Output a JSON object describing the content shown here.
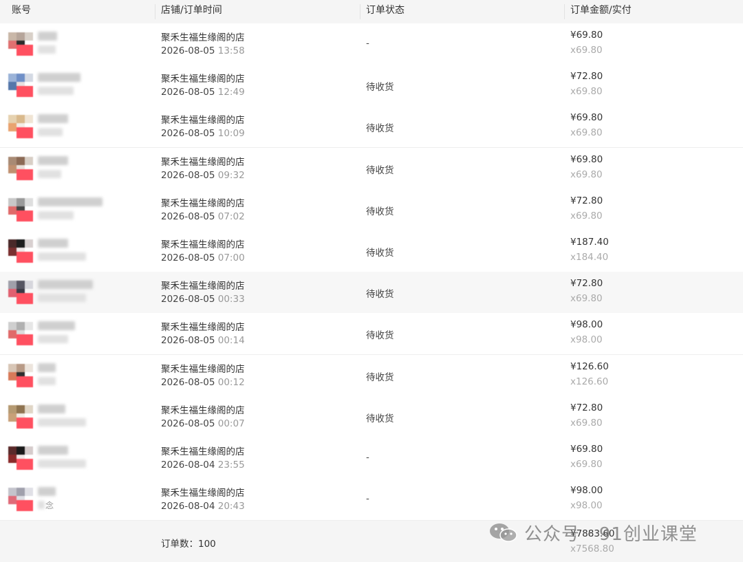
{
  "header": {
    "account": "账号",
    "shop_time": "店铺/订单时间",
    "status": "订单状态",
    "amount": "订单金额/实付"
  },
  "rows": [
    {
      "shop": "聚禾生福生缘阁的店",
      "date": "2026-08-05",
      "time": "13:58",
      "status": "-",
      "amount": "¥69.80",
      "paid": "x69.80",
      "avatar": [
        "#c9b7a8",
        "#b6a59a",
        "#d8d0c8",
        "#e07070",
        "#2b2b2b",
        "#ff5060"
      ],
      "name_w": 28,
      "sub_w": 26,
      "note": ""
    },
    {
      "shop": "聚禾生福生缘阁的店",
      "date": "2026-08-05",
      "time": "12:49",
      "status": "待收货",
      "amount": "¥72.80",
      "paid": "x69.80",
      "avatar": [
        "#9bb3d8",
        "#6f8fc7",
        "#d4d9e3",
        "#5577aa",
        "#e8e0e0",
        "#ff5060"
      ],
      "name_w": 62,
      "sub_w": 52,
      "note": ""
    },
    {
      "shop": "聚禾生福生缘阁的店",
      "date": "2026-08-05",
      "time": "10:09",
      "status": "待收货",
      "amount": "¥69.80",
      "paid": "x69.80",
      "avatar": [
        "#e6d2b0",
        "#d9b98c",
        "#f0e4d4",
        "#e9a36f",
        "#f3ede6",
        "#ff5060"
      ],
      "name_w": 44,
      "sub_w": 36,
      "note": ""
    },
    {
      "shop": "聚禾生福生缘阁的店",
      "date": "2026-08-05",
      "time": "09:32",
      "status": "待收货",
      "amount": "¥69.80",
      "paid": "x69.80",
      "avatar": [
        "#a88a74",
        "#8b6a55",
        "#d8cfc6",
        "#c09070",
        "#e8e0da",
        "#ff5060"
      ],
      "name_w": 44,
      "sub_w": 34,
      "note": ""
    },
    {
      "shop": "聚禾生福生缘阁的店",
      "date": "2026-08-05",
      "time": "07:02",
      "status": "待收货",
      "amount": "¥72.80",
      "paid": "x69.80",
      "avatar": [
        "#c8c8c8",
        "#9a9a9a",
        "#dedede",
        "#e06a6a",
        "#444",
        "#ff5060"
      ],
      "name_w": 94,
      "sub_w": 52,
      "note": ""
    },
    {
      "shop": "聚禾生福生缘阁的店",
      "date": "2026-08-05",
      "time": "07:00",
      "status": "待收货",
      "amount": "¥187.40",
      "paid": "x184.40",
      "avatar": [
        "#4a2a2a",
        "#1e1e1e",
        "#d8d0d0",
        "#7a3030",
        "#f0e8e8",
        "#ff5060"
      ],
      "name_w": 44,
      "sub_w": 70,
      "note": ""
    },
    {
      "shop": "聚禾生福生缘阁的店",
      "date": "2026-08-05",
      "time": "00:33",
      "status": "待收货",
      "amount": "¥72.80",
      "paid": "x69.80",
      "avatar": [
        "#a0a0aa",
        "#555562",
        "#d6d6dc",
        "#e06070",
        "#3a3a46",
        "#ff5060"
      ],
      "name_w": 80,
      "sub_w": 70,
      "note": ""
    },
    {
      "shop": "聚禾生福生缘阁的店",
      "date": "2026-08-05",
      "time": "00:14",
      "status": "待收货",
      "amount": "¥98.00",
      "paid": "x98.00",
      "avatar": [
        "#cfcfcf",
        "#b0b0b0",
        "#e6e6e6",
        "#e06a6a",
        "#dcdcdc",
        "#ff5060"
      ],
      "name_w": 54,
      "sub_w": 44,
      "note": ""
    },
    {
      "shop": "聚禾生福生缘阁的店",
      "date": "2026-08-05",
      "time": "00:12",
      "status": "待收货",
      "amount": "¥126.60",
      "paid": "x126.60",
      "avatar": [
        "#d8c6b6",
        "#b89a86",
        "#ece4dc",
        "#d87a5a",
        "#2e2e2e",
        "#ff5060"
      ],
      "name_w": 26,
      "sub_w": 26,
      "note": ""
    },
    {
      "shop": "聚禾生福生缘阁的店",
      "date": "2026-08-05",
      "time": "00:07",
      "status": "待收货",
      "amount": "¥72.80",
      "paid": "x69.80",
      "avatar": [
        "#b59a72",
        "#8e7350",
        "#e0d6c6",
        "#c8a078",
        "#f2ece4",
        "#ff5060"
      ],
      "name_w": 40,
      "sub_w": 70,
      "note": ""
    },
    {
      "shop": "聚禾生福生缘阁的店",
      "date": "2026-08-04",
      "time": "23:55",
      "status": "-",
      "amount": "¥69.80",
      "paid": "x69.80",
      "avatar": [
        "#5a2a2a",
        "#1a1a1a",
        "#d6cccc",
        "#8a2a2a",
        "#f0e6e6",
        "#ff5060"
      ],
      "name_w": 44,
      "sub_w": 70,
      "note": ""
    },
    {
      "shop": "聚禾生福生缘阁的店",
      "date": "2026-08-04",
      "time": "20:43",
      "status": "-",
      "amount": "¥98.00",
      "paid": "x98.00",
      "avatar": [
        "#c4c4cc",
        "#a0a0ac",
        "#e0e0e6",
        "#e06a78",
        "#dedee4",
        "#ff5060"
      ],
      "name_w": 26,
      "sub_w": 10,
      "note": "念"
    }
  ],
  "footer": {
    "order_count": "订单数：100",
    "total_amount": "¥7883.60",
    "total_paid": "x7568.80"
  },
  "watermark": {
    "text": "公众号 · 91创业课堂",
    "icon": "wechat-icon"
  },
  "highlight_row_index": 6
}
